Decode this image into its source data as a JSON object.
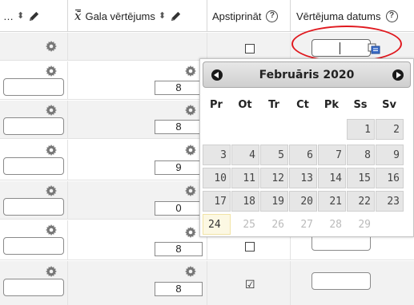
{
  "header": {
    "col1_label": "…",
    "col2_label": "Gala vērtējums",
    "col3_label": "Apstiprināt",
    "col4_label": "Vērtējuma datums",
    "xbar_symbol": "x̄"
  },
  "rows": [
    {
      "grade": "",
      "approved": ""
    },
    {
      "grade": "8",
      "approved": ""
    },
    {
      "grade": "8",
      "approved": ""
    },
    {
      "grade": "9",
      "approved": ""
    },
    {
      "grade": "0",
      "approved": ""
    },
    {
      "grade": "8",
      "approved": ""
    },
    {
      "grade": "8",
      "approved": "☑"
    }
  ],
  "calendar": {
    "title": "Februāris 2020",
    "weekdays": [
      "Pr",
      "Ot",
      "Tr",
      "Ct",
      "Pk",
      "Ss",
      "Sv"
    ],
    "days": [
      "1",
      "2",
      "3",
      "4",
      "5",
      "6",
      "7",
      "8",
      "9",
      "10",
      "11",
      "12",
      "13",
      "14",
      "15",
      "16",
      "17",
      "18",
      "19",
      "20",
      "21",
      "22",
      "23",
      "24",
      "25",
      "26",
      "27",
      "28",
      "29"
    ],
    "today": "24"
  },
  "colors": {
    "highlight_ring": "#e0191f",
    "alt_row": "#f2f2f2",
    "today_bg": "#fcf8e3"
  },
  "icons": [
    "sort-icon",
    "pencil-icon",
    "help-icon",
    "gear-icon",
    "copy-icon",
    "prev-month-icon",
    "next-month-icon"
  ]
}
